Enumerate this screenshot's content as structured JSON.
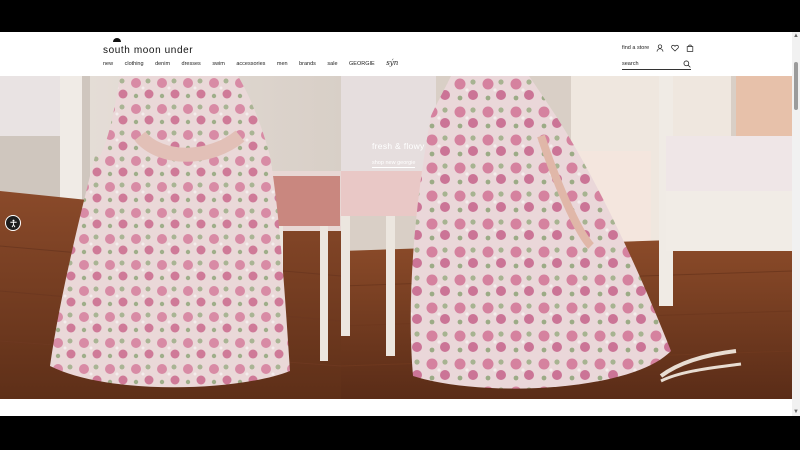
{
  "brand": {
    "name": "south moon under"
  },
  "nav": {
    "items": [
      {
        "label": "new"
      },
      {
        "label": "clothing"
      },
      {
        "label": "denim"
      },
      {
        "label": "dresses"
      },
      {
        "label": "swim"
      },
      {
        "label": "accessories"
      },
      {
        "label": "men"
      },
      {
        "label": "brands"
      },
      {
        "label": "sale"
      },
      {
        "label": "GEORGIE"
      },
      {
        "label": "sýn"
      }
    ]
  },
  "utility": {
    "find_store": "find a store",
    "icons": [
      "user-icon",
      "heart-icon",
      "bag-icon"
    ]
  },
  "search": {
    "placeholder": "search"
  },
  "hero": {
    "title": "fresh & flowy",
    "link": "shop new georgie"
  },
  "colors": {
    "text": "#222222",
    "hero_text": "#ffffff",
    "floor": "#7a3e22",
    "dress_pink": "#d98aa6"
  }
}
